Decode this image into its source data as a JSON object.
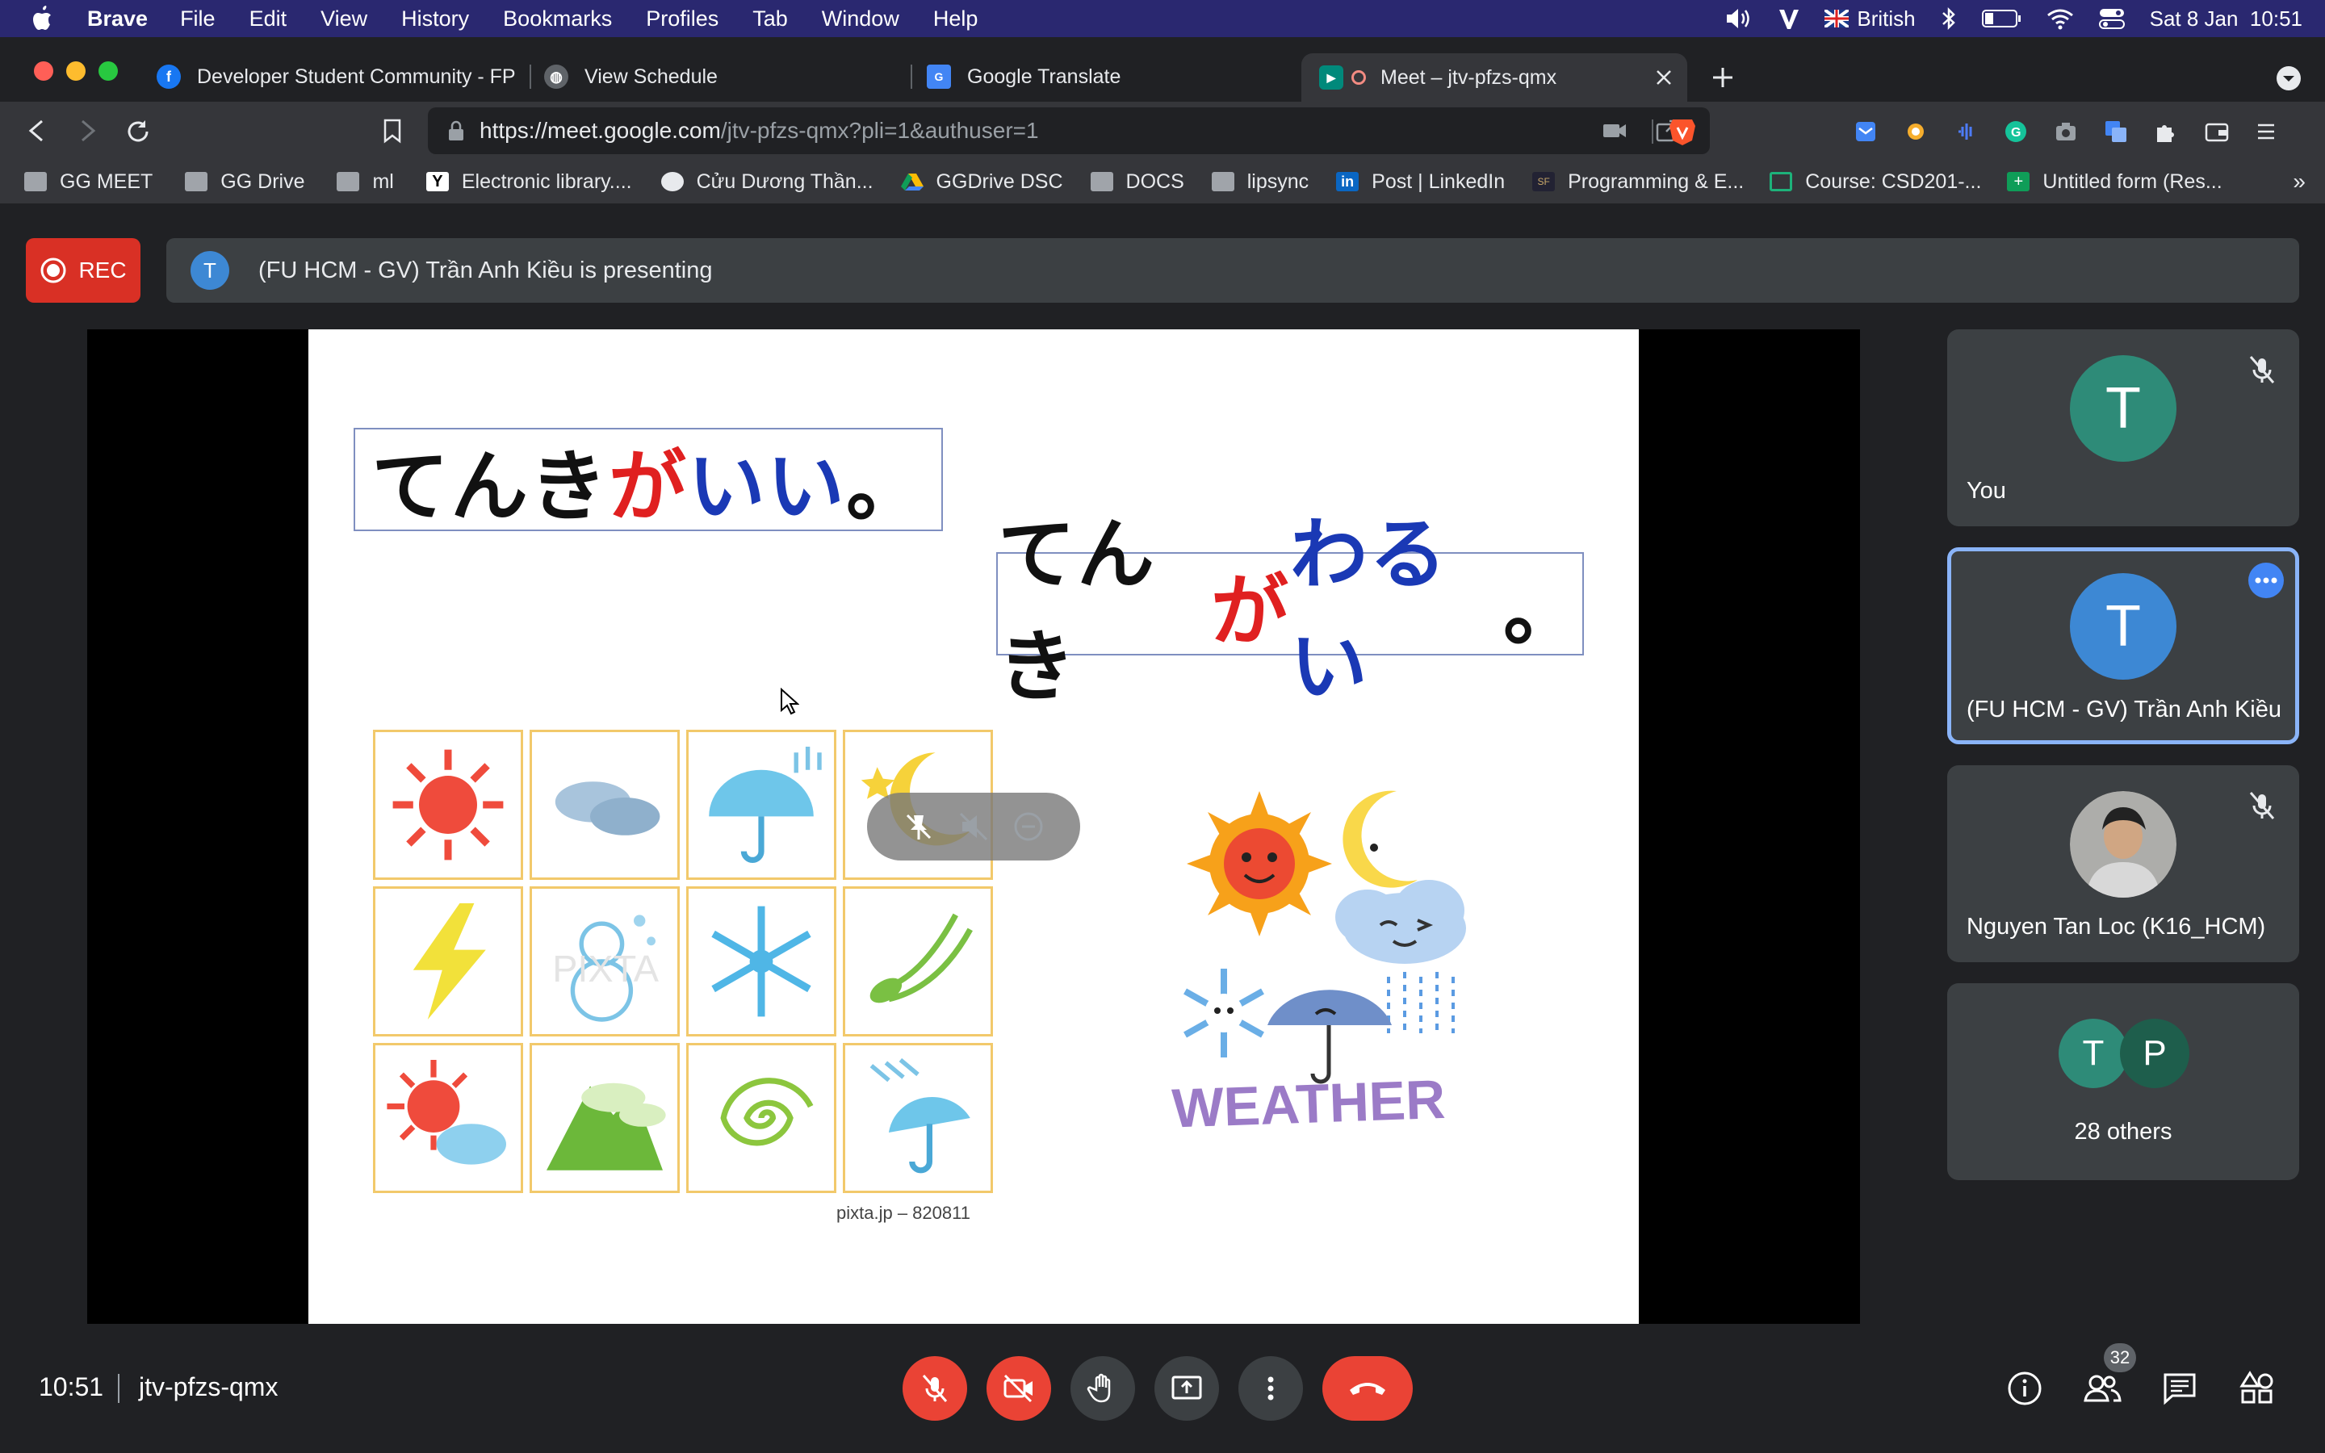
{
  "menubar": {
    "app": "Brave",
    "items": [
      "File",
      "Edit",
      "View",
      "History",
      "Bookmarks",
      "Profiles",
      "Tab",
      "Window",
      "Help"
    ],
    "input_source": "British",
    "datetime": "Sat 8 Jan  10:51"
  },
  "tabs": [
    {
      "title": "Developer Student Community - FP",
      "icon": "facebook-icon"
    },
    {
      "title": "View Schedule",
      "icon": "globe-icon"
    },
    {
      "title": "Google Translate",
      "icon": "translate-icon"
    },
    {
      "title": "Meet – jtv-pfzs-qmx",
      "icon": "meet-icon",
      "active": true
    }
  ],
  "url": {
    "host": "https://meet.google.com",
    "path": "/jtv-pfzs-qmx?pli=1&authuser=1"
  },
  "bookmarks": [
    {
      "label": "GG MEET",
      "icon": "folder-icon"
    },
    {
      "label": "GG Drive",
      "icon": "folder-icon"
    },
    {
      "label": "ml",
      "icon": "folder-icon"
    },
    {
      "label": "Electronic library....",
      "icon": "y-icon"
    },
    {
      "label": "Cửu Dương Thần...",
      "icon": "globe-icon"
    },
    {
      "label": "GGDrive DSC",
      "icon": "drive-icon"
    },
    {
      "label": "DOCS",
      "icon": "folder-icon"
    },
    {
      "label": "lipsync",
      "icon": "folder-icon"
    },
    {
      "label": "Post | LinkedIn",
      "icon": "linkedin-icon"
    },
    {
      "label": "Programming & E...",
      "icon": "sf-icon"
    },
    {
      "label": "Course: CSD201-...",
      "icon": "course-icon"
    },
    {
      "label": "Untitled form (Res...",
      "icon": "form-icon"
    }
  ],
  "bookmarks_more": "»",
  "meet": {
    "rec_label": "REC",
    "presenter_initial": "T",
    "presenting_text": "(FU HCM - GV) Trần Anh Kiều is presenting",
    "slide": {
      "phrase1": {
        "black": "てんき",
        "red": "が",
        "blue": "いい",
        "tail": "。"
      },
      "phrase2": {
        "black": "てんき",
        "red": "が",
        "blue": "わるい",
        "tail": "。"
      },
      "credit": "pixta.jp – 820811",
      "watermark": "PIXTA",
      "weather_word": "WEATHER"
    },
    "participants": [
      {
        "initial": "T",
        "name": "You",
        "color": "#2e8b78",
        "muted": true
      },
      {
        "initial": "T",
        "name": "(FU HCM - GV) Trần Anh Kiều",
        "color": "#3d88d4",
        "muted": false,
        "pinned": true
      },
      {
        "initial": "",
        "name": "Nguyen Tan Loc (K16_HCM)",
        "color": "#8a6a50",
        "muted": true
      },
      {
        "initials": [
          "T",
          "P"
        ],
        "name": "28 others"
      }
    ],
    "time": "10:51",
    "meeting_code": "jtv-pfzs-qmx",
    "people_count": "32"
  }
}
